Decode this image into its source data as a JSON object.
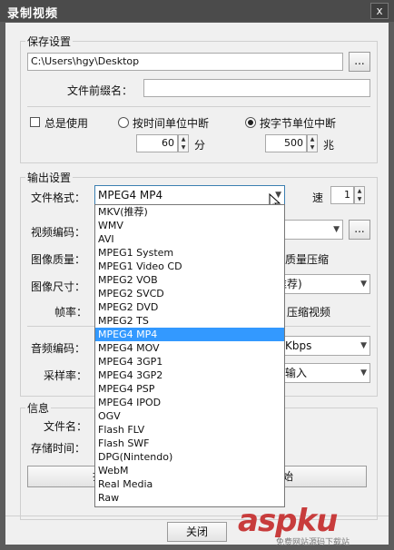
{
  "window": {
    "title": "录制视频",
    "close_glyph": "x"
  },
  "save_settings": {
    "group_label": "保存设置",
    "path_value": "C:\\Users\\hgy\\Desktop",
    "browse_label": "...",
    "prefix_label": "文件前缀名：",
    "prefix_value": "",
    "always_use_label": "总是使用",
    "by_time_label": "按时间单位中断",
    "by_size_label": "按字节单位中断",
    "time_value": "60",
    "time_unit": "分",
    "size_value": "500",
    "size_unit": "兆",
    "spin_up": "▲",
    "spin_down": "▼"
  },
  "output_settings": {
    "group_label": "输出设置",
    "format_label": "文件格式：",
    "format_value": "MPEG4 MP4",
    "speed_label": "速",
    "speed_value": "1",
    "video_codec_label": "视频编码：",
    "video_codec_browse": "...",
    "image_quality_label": "图像质量：",
    "quality_compress_text": "质量压缩",
    "image_size_label": "图像尺寸：",
    "image_size_value": "推荐)",
    "framerate_label": "帧率：",
    "compress_video_text": "压缩视频",
    "audio_codec_label": "音频编码：",
    "audio_codec_value": "Kbps",
    "samplerate_label": "采样率：",
    "samplerate_value": "输入",
    "arrow_glyph": "▼"
  },
  "info": {
    "group_label": "信息",
    "filename_label": "文件名：",
    "savetime_label": "存储时间：",
    "open_button_label": "打开",
    "start_button_label": "始"
  },
  "footer": {
    "close_button_label": "关闭"
  },
  "dropdown": {
    "options": [
      "MKV(推荐)",
      "WMV",
      "AVI",
      "MPEG1 System",
      "MPEG1 Video CD",
      "MPEG2 VOB",
      "MPEG2 SVCD",
      "MPEG2 DVD",
      "MPEG2 TS",
      "MPEG4 MP4",
      "MPEG4 MOV",
      "MPEG4 3GP1",
      "MPEG4 3GP2",
      "MPEG4 PSP",
      "MPEG4 IPOD",
      "OGV",
      "Flash FLV",
      "Flash SWF",
      "DPG(Nintendo)",
      "WebM",
      "Real Media",
      "Raw"
    ],
    "selected": "MPEG4 MP4"
  },
  "watermark": {
    "big": "aspku",
    "small": "免费网站源码下载站"
  },
  "colors": {
    "selection": "#3399ff",
    "titlebar": "#4b4b4b",
    "watermark": "#c83c3c"
  }
}
